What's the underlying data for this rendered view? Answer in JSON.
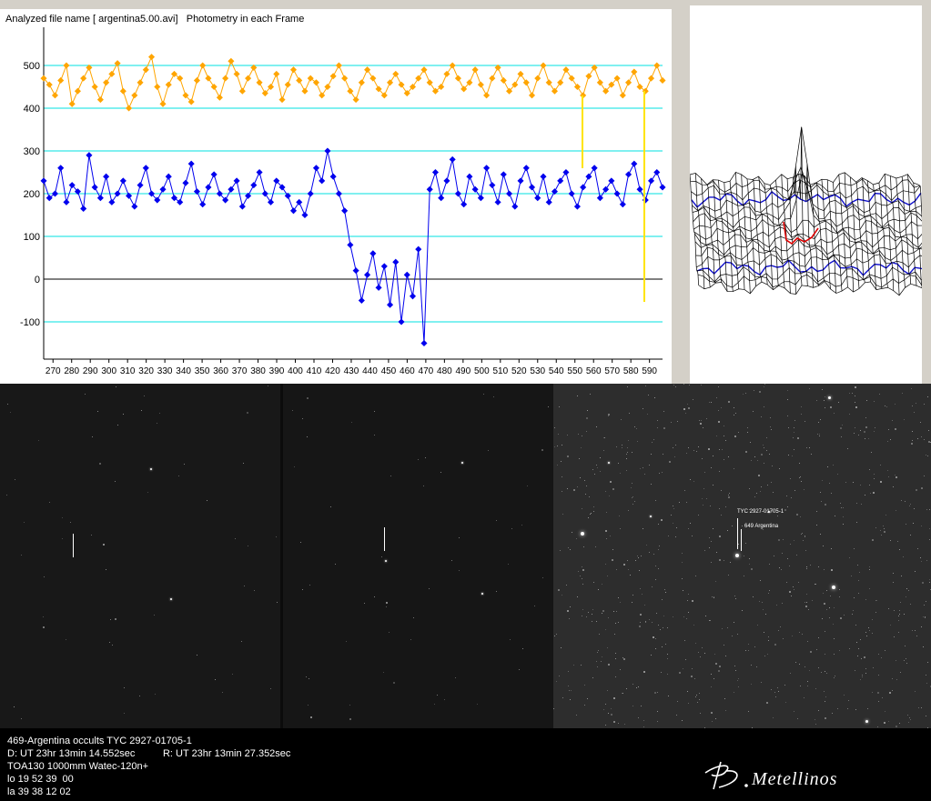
{
  "chart": {
    "title": "Analyzed file name [ argentina5.00.avi]   Photometry in each Frame",
    "y_ticks": [
      "500",
      "400",
      "300",
      "200",
      "100",
      "0",
      "-100"
    ],
    "x_ticks": [
      "270",
      "280",
      "290",
      "300",
      "310",
      "320",
      "330",
      "340",
      "350",
      "360",
      "370",
      "380",
      "390",
      "400",
      "410",
      "420",
      "430",
      "440",
      "450",
      "460",
      "470",
      "480",
      "490",
      "500",
      "510",
      "520",
      "530",
      "540",
      "550",
      "560",
      "570",
      "580",
      "590"
    ],
    "series_colors": {
      "comparison": "#ffa500",
      "target": "#0000ee",
      "gridline": "#00e0e0",
      "zero_line": "#000000",
      "marker_line": "#ffe400"
    }
  },
  "chart_data": {
    "type": "line",
    "title": "Photometry in each Frame",
    "xlabel": "",
    "ylabel": "",
    "xlim": [
      265,
      597
    ],
    "ylim": [
      -190,
      560
    ],
    "series": [
      {
        "values": [
          470,
          455,
          430,
          465,
          500,
          410,
          440,
          470,
          495,
          450,
          420,
          460,
          480,
          505,
          440,
          400,
          430,
          460,
          490,
          520,
          450,
          410,
          455,
          480,
          470,
          430,
          415,
          465,
          500,
          470,
          450,
          425,
          470,
          510,
          480,
          440,
          470,
          495,
          460,
          435,
          450,
          480,
          420,
          455,
          490,
          465,
          440,
          470,
          460,
          430,
          450,
          475,
          500,
          470,
          440,
          420,
          460,
          490,
          470,
          445,
          430,
          460,
          480,
          455,
          435,
          450,
          470,
          490,
          460,
          440,
          450,
          480,
          500,
          470,
          445,
          460,
          490,
          455,
          430,
          470,
          495,
          465,
          440,
          455,
          480,
          460,
          430,
          470,
          500,
          460,
          440,
          460,
          490,
          470,
          450,
          430,
          475,
          495,
          460,
          440,
          455,
          470,
          430,
          460,
          485,
          450,
          440,
          470,
          500,
          465
        ]
      },
      {
        "values": [
          230,
          190,
          200,
          260,
          180,
          220,
          205,
          165,
          290,
          215,
          190,
          240,
          180,
          200,
          230,
          195,
          170,
          220,
          260,
          200,
          185,
          210,
          240,
          190,
          180,
          225,
          270,
          205,
          175,
          215,
          245,
          200,
          185,
          210,
          230,
          170,
          195,
          220,
          250,
          200,
          180,
          230,
          215,
          195,
          160,
          180,
          150,
          200,
          260,
          230,
          300,
          240,
          200,
          160,
          80,
          20,
          -50,
          10,
          60,
          -20,
          30,
          -60,
          40,
          -100,
          10,
          -40,
          70,
          -150,
          210,
          250,
          190,
          230,
          280,
          200,
          175,
          240,
          210,
          190,
          260,
          220,
          180,
          245,
          200,
          170,
          230,
          260,
          215,
          190,
          240,
          180,
          205,
          230,
          250,
          200,
          170,
          215,
          240,
          260,
          190,
          210,
          230,
          200,
          175,
          245,
          270,
          210,
          185,
          230,
          250,
          215
        ]
      }
    ]
  },
  "frames": {
    "target_label": "TYC 2927-01705-1",
    "asteroid_label": "649 Argentina"
  },
  "info": {
    "line1": "469-Argentina occults TYC 2927-01705-1",
    "line2": "D: UT 23hr 13min 14.552sec          R: UT 23hr 13min 27.352sec",
    "line3": "TOA130 1000mm Watec-120n+",
    "line4": "lo 19 52 39  00",
    "line5": "la 39 38 12 02",
    "signature": "B.Metellinos"
  }
}
